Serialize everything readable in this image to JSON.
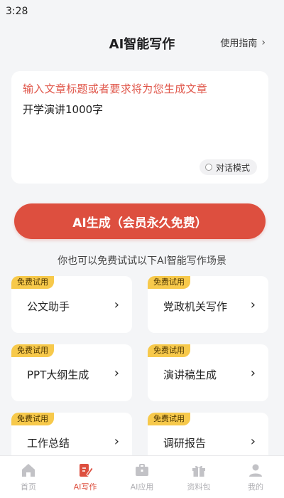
{
  "status_bar": {
    "time": "3:28"
  },
  "header": {
    "title": "AI智能写作",
    "guide_label": "使用指南",
    "guide_chevron": "›"
  },
  "input": {
    "placeholder": "输入文章标题或者要求将为您生成文章",
    "value": "开学演讲1000字",
    "chat_mode_label": "对话模式"
  },
  "generate_button": "AI生成（会员永久免费）",
  "subtitle": "你也可以免费试试以下AI智能写作场景",
  "scenarios": [
    {
      "badge": "免费试用",
      "label": "公文助手",
      "arrow": "›"
    },
    {
      "badge": "免费试用",
      "label": "党政机关写作",
      "arrow": "›"
    },
    {
      "badge": "免费试用",
      "label": "PPT大纲生成",
      "arrow": "›"
    },
    {
      "badge": "免费试用",
      "label": "演讲稿生成",
      "arrow": "›"
    },
    {
      "badge": "免费试用",
      "label": "工作总结",
      "arrow": "›"
    },
    {
      "badge": "免费试用",
      "label": "调研报告",
      "arrow": "›"
    }
  ],
  "tabs": [
    {
      "label": "首页",
      "icon": "home-icon"
    },
    {
      "label": "AI写作",
      "icon": "write-icon",
      "active": true
    },
    {
      "label": "AI应用",
      "icon": "briefcase-icon"
    },
    {
      "label": "资料包",
      "icon": "gift-icon"
    },
    {
      "label": "我的",
      "icon": "profile-icon"
    }
  ],
  "colors": {
    "accent": "#dd4f3f",
    "badge": "#f7c94b",
    "inactive_tab": "#b0b0b4"
  }
}
